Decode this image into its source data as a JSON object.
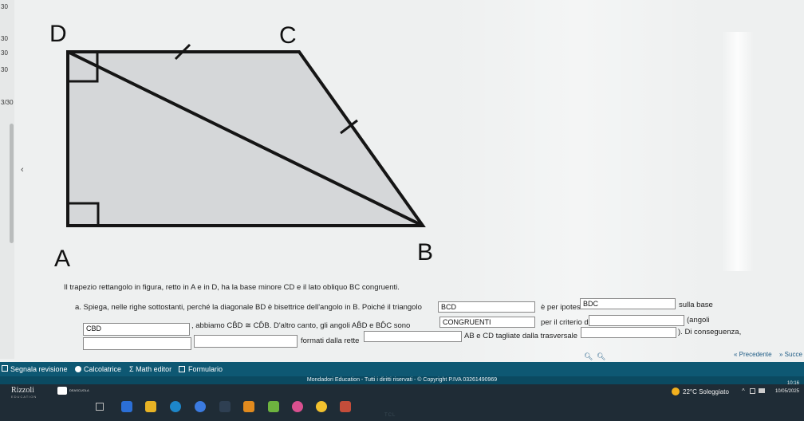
{
  "sidebar": {
    "numbers": [
      "30",
      "30",
      "30",
      "30",
      "3/30"
    ],
    "collapse_glyph": "‹"
  },
  "figure": {
    "vertices": {
      "D": "D",
      "C": "C",
      "A": "A",
      "B": "B"
    },
    "fill_color": "#d5d7d9",
    "stroke_color": "#151515"
  },
  "exercise": {
    "intro": "Il trapezio rettangolo in figura, retto in A e in D, ha la base minore CD e il lato obliquo BC congruenti.",
    "part_a": {
      "line1_start": "a. Spiega, nelle righe sottostanti, perché la diagonale BD è bisettrice dell'angolo in B. Poiché il triangolo",
      "answer1": "BCD",
      "line1_mid": "è per ipotesi",
      "answer2": "BDC",
      "line1_end": "sulla base",
      "answer3": "CBD",
      "line2_a": ", abbiamo CB̂D ≅ CD̂B. D'altro canto, gli angoli AB̂D e BD̂C sono",
      "answer4": "CONGRUENTI",
      "line2_b": "per il criterio di",
      "answer5": "",
      "line2_c": "(angoli",
      "answer6": "",
      "answer7": "",
      "line3_a": "formati dalla rette",
      "answer8": "",
      "line3_b": "AB e CD tagliate dalla trasversale",
      "answer9": "",
      "line3_c": "). Di conseguenza,"
    }
  },
  "navigation": {
    "prev_label": "« Precedente",
    "next_label": "» Succe"
  },
  "toolbar": {
    "report_label": "Segnala revisione",
    "calculator_label": "Calcolatrice",
    "math_editor_label": "Σ Math editor",
    "formulary_label": "Formulario"
  },
  "footer": {
    "copyright": "Mondadori Education - Tutti i diritti riservati - © Copyright P.IVA 03261490969"
  },
  "taskbar": {
    "brand_left": "Rizzoli",
    "brand_left_sub": "EDUCATION",
    "brand_right": "DEASCUOLA",
    "weather": "22°C Soleggiato",
    "time": "10:16",
    "date": "10/05/2025",
    "monitor_brand": "TCL"
  }
}
